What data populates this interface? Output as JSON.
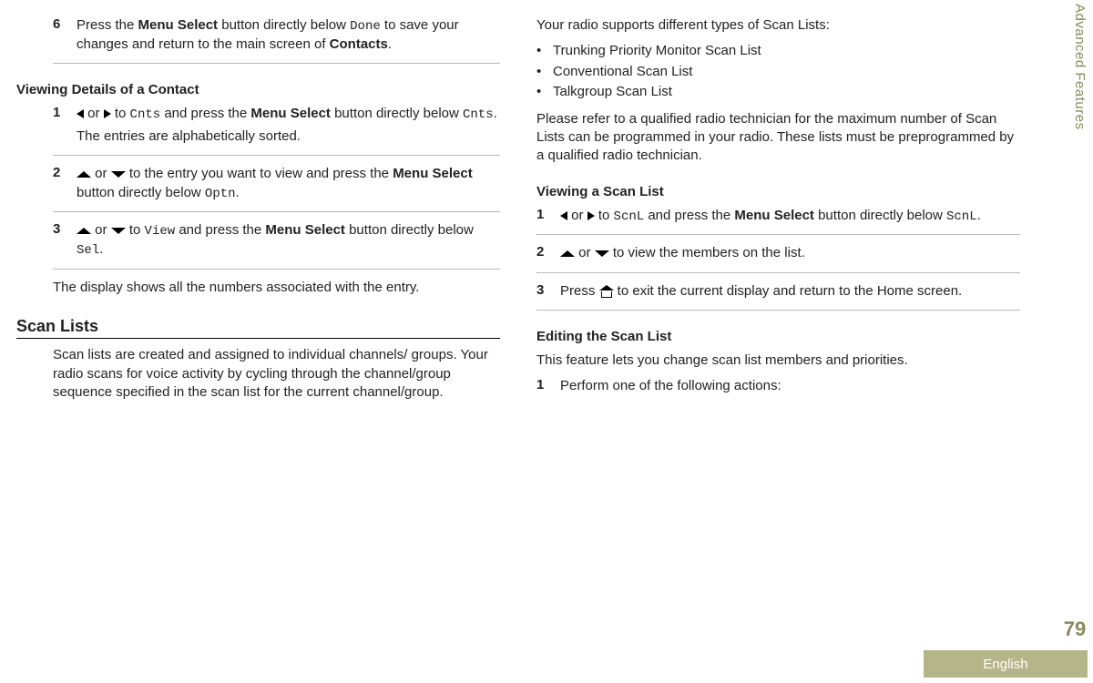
{
  "sideTab": "Advanced Features",
  "pageNumber": "79",
  "language": "English",
  "left": {
    "step6": {
      "num": "6",
      "pre": "Press the ",
      "b1": "Menu Select",
      "mid1": " button directly below ",
      "code1": "Done",
      "mid2": " to save your changes and return to the main screen of ",
      "b2": "Contacts",
      "post": "."
    },
    "viewDetailsHeading": "Viewing Details of a Contact",
    "vd1": {
      "num": "1",
      "mid1": " or ",
      "mid2": " to ",
      "code1": "Cnts",
      "mid3": " and press the ",
      "b1": "Menu Select",
      "mid4": " button directly below ",
      "code2": "Cnts",
      "post": ".",
      "line2": "The entries are alphabetically sorted."
    },
    "vd2": {
      "num": "2",
      "mid1": " or ",
      "mid2": " to the entry you want to view and press the ",
      "b1": "Menu Select",
      "mid3": " button directly below ",
      "code1": "Optn",
      "post": "."
    },
    "vd3": {
      "num": "3",
      "mid1": " or ",
      "mid2": " to ",
      "code1": "View",
      "mid3": " and press the ",
      "b1": "Menu Select",
      "mid4": " button directly below ",
      "code2": "Sel",
      "post": "."
    },
    "vdResult": "The display shows all the numbers associated with the entry.",
    "scanListsHeading": "Scan Lists",
    "scanListsPara": "Scan lists are created and assigned to individual channels/ groups. Your radio scans for voice activity by cycling through the channel/group sequence specified in the scan list for the current channel/group."
  },
  "right": {
    "intro": "Your radio supports different types of Scan Lists:",
    "bullets": [
      "Trunking Priority Monitor Scan List",
      "Conventional Scan List",
      "Talkgroup Scan List"
    ],
    "note": "Please refer to a qualified radio technician for the maximum number of Scan Lists can be programmed in your radio. These lists must be preprogrammed by a qualified radio technician.",
    "viewScanHeading": "Viewing a Scan List",
    "vs1": {
      "num": "1",
      "mid1": " or ",
      "mid2": " to ",
      "code1": "ScnL",
      "mid3": " and press the ",
      "b1": "Menu Select",
      "mid4": " button directly below ",
      "code2": "ScnL",
      "post": "."
    },
    "vs2": {
      "num": "2",
      "mid1": " or ",
      "mid2": " to view the members on the list."
    },
    "vs3": {
      "num": "3",
      "pre": "Press ",
      "post": " to exit the current display and return to the Home screen."
    },
    "editHeading": "Editing the Scan List",
    "editPara": "This feature lets you change scan list members and priorities.",
    "edit1": {
      "num": "1",
      "text": "Perform one of the following actions:"
    }
  }
}
